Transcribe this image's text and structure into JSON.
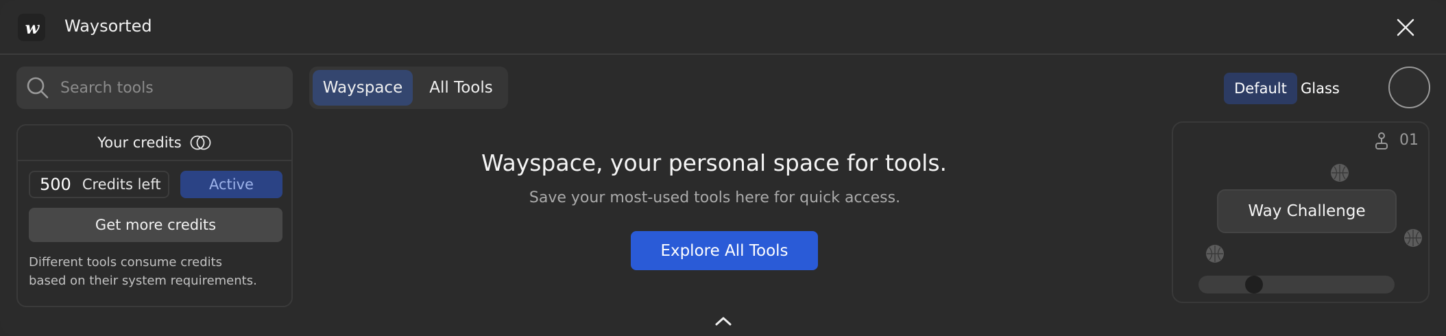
{
  "app": {
    "title": "Waysorted",
    "logo_text": "w"
  },
  "search": {
    "placeholder": "Search tools",
    "value": ""
  },
  "tabs": [
    {
      "label": "Wayspace",
      "active": true
    },
    {
      "label": "All Tools",
      "active": false
    }
  ],
  "credits": {
    "title": "Your credits",
    "amount": "500",
    "amount_label": "Credits left",
    "status": "Active",
    "get_more_label": "Get more credits",
    "note_line1": "Different tools consume credits",
    "note_line2": "based on their system requirements."
  },
  "hero": {
    "title": "Wayspace, your personal space for tools.",
    "subtitle": "Save your most-used tools here for quick access.",
    "cta_label": "Explore All Tools"
  },
  "theme": {
    "options": [
      "Default",
      "Glass"
    ],
    "selected": "Default"
  },
  "game": {
    "level": "01",
    "challenge_label": "Way Challenge"
  },
  "colors": {
    "background": "#2b2b2b",
    "accent": "#2a5bd7",
    "active_tab": "#34466f",
    "active_badge": "#2b4385"
  },
  "icons": [
    "logo-icon",
    "close-icon",
    "search-icon",
    "coins-icon",
    "chevron-up-icon",
    "joystick-icon",
    "basketball-icon",
    "avatar"
  ]
}
